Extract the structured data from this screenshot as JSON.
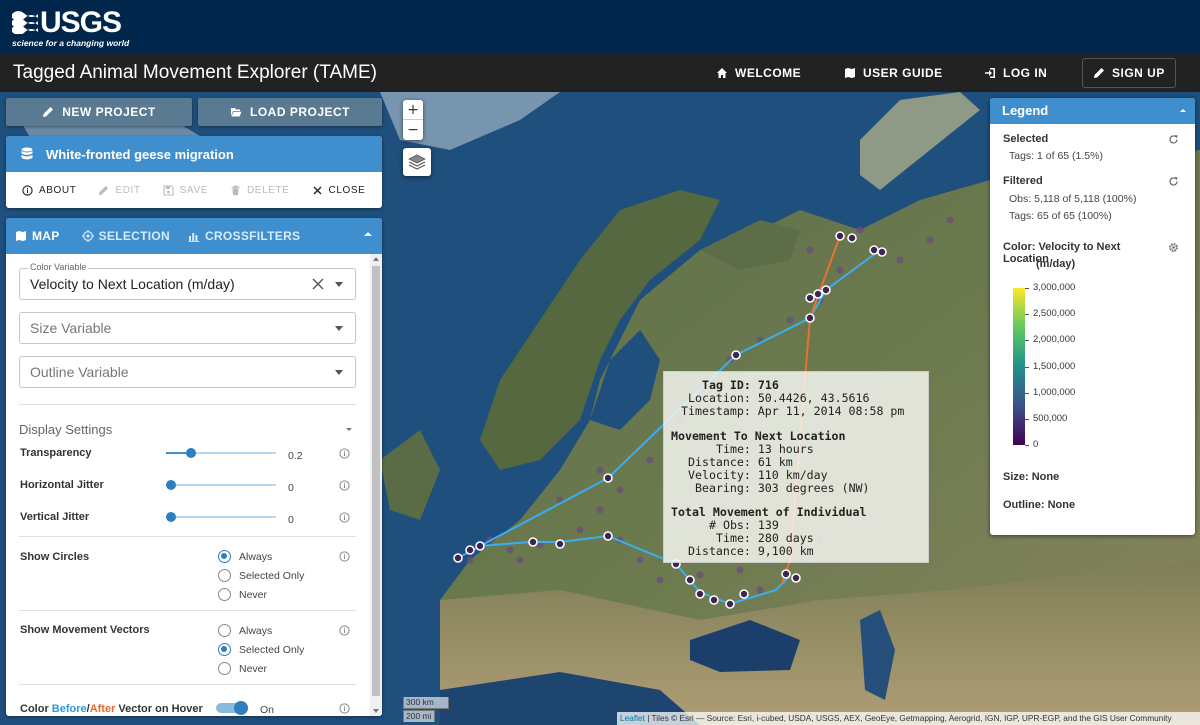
{
  "usgs": {
    "logo_word": "USGS",
    "tagline": "science for a changing world"
  },
  "app": {
    "title": "Tagged Animal Movement Explorer (TAME)"
  },
  "nav": {
    "welcome": "WELCOME",
    "user_guide": "USER GUIDE",
    "log_in": "LOG IN",
    "sign_up": "SIGN UP"
  },
  "project": {
    "new_label": "NEW PROJECT",
    "load_label": "LOAD PROJECT",
    "name": "White-fronted geese migration",
    "actions": {
      "about": "ABOUT",
      "edit": "EDIT",
      "save": "SAVE",
      "delete": "DELETE",
      "close": "CLOSE"
    }
  },
  "tabs": {
    "map": "MAP",
    "selection": "SELECTION",
    "crossfilters": "CROSSFILTERS"
  },
  "map_settings": {
    "color_variable_label": "Color Variable",
    "color_variable_value": "Velocity to Next Location (m/day)",
    "size_placeholder": "Size Variable",
    "outline_placeholder": "Outline Variable",
    "display_settings": "Display Settings",
    "transparency_label": "Transparency",
    "transparency_value": "0.2",
    "transparency_fraction": 0.2,
    "h_jitter_label": "Horizontal Jitter",
    "h_jitter_value": "0",
    "v_jitter_label": "Vertical Jitter",
    "v_jitter_value": "0",
    "show_circles_label": "Show Circles",
    "show_circles_options": [
      "Always",
      "Selected Only",
      "Never"
    ],
    "show_circles_selected": "Always",
    "show_vectors_label": "Show Movement Vectors",
    "show_vectors_options": [
      "Always",
      "Selected Only",
      "Never"
    ],
    "show_vectors_selected": "Selected Only",
    "hover_label_pre": "Color ",
    "hover_label_before": "Before",
    "hover_label_slash": "/",
    "hover_label_after": "After",
    "hover_label_post": " Vector on Hover",
    "hover_toggle_value": "On"
  },
  "map_controls": {
    "zoom_in": "+",
    "zoom_out": "−"
  },
  "tooltip": {
    "tag_id_label": "Tag ID:",
    "tag_id": "716",
    "location_label": "Location:",
    "location": "50.4426, 43.5616",
    "timestamp_label": "Timestamp:",
    "timestamp": "Apr 11, 2014 08:58 pm",
    "next_header": "Movement To Next Location",
    "time_label": "Time:",
    "time": "13 hours",
    "distance_label": "Distance:",
    "distance": "61 km",
    "velocity_label": "Velocity:",
    "velocity": "110 km/day",
    "bearing_label": "Bearing:",
    "bearing": "303 degrees (NW)",
    "total_header": "Total Movement of Individual",
    "obs_label": "# Obs:",
    "obs": "139",
    "total_time_label": "Time:",
    "total_time": "280 days",
    "total_distance_label": "Distance:",
    "total_distance": "9,100 km"
  },
  "legend": {
    "title": "Legend",
    "selected_title": "Selected",
    "selected_tags": "Tags: 1 of 65 (1.5%)",
    "filtered_title": "Filtered",
    "filtered_obs": "Obs: 5,118 of 5,118 (100%)",
    "filtered_tags": "Tags: 65 of 65 (100%)",
    "color_title": "Color: Velocity to Next Location",
    "color_unit": "(m/day)",
    "colorbar_ticks": [
      "3,000,000",
      "2,500,000",
      "2,000,000",
      "1,500,000",
      "1,000,000",
      "500,000",
      "0"
    ],
    "size_label": "Size: None",
    "outline_label": "Outline: None"
  },
  "scale": {
    "km": "300 km",
    "mi": "200 mi"
  },
  "attribution": {
    "leaflet": "Leaflet",
    "rest": " | Tiles © Esri — Source: Esri, i-cubed, USDA, USGS, AEX, GeoEye, Getmapping, Aerogrid, IGN, IGP, UPR-EGP, and the GIS User Community"
  },
  "colors": {
    "usgs_blue": "#00264c",
    "app_bar": "#222222",
    "accent": "#3f8fcf",
    "before_vector": "#2e9be0",
    "after_vector": "#e26a2c"
  }
}
